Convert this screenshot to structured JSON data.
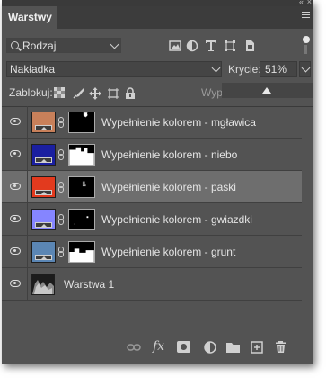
{
  "panel": {
    "tab_label": "Warstwy",
    "collapse_glyph": "«",
    "close_glyph": "×"
  },
  "filter": {
    "kind_label": "Rodzaj",
    "filter_icons": [
      "image-filter-icon",
      "adjustment-filter-icon",
      "type-filter-icon",
      "shape-filter-icon",
      "smart-object-filter-icon"
    ]
  },
  "blend": {
    "mode": "Nakładka",
    "opacity_label": "Krycie:",
    "opacity_value": "51%",
    "opacity_slider_percent": 51
  },
  "lock": {
    "label": "Zablokuj:",
    "fill_label": "Wyp"
  },
  "layers": [
    {
      "name": "Wypełnienie kolorem - mgławica",
      "color": "#c8805a",
      "selected": false,
      "mask": "nebula"
    },
    {
      "name": "Wypełnienie kolorem - niebo",
      "color": "#1a1fa0",
      "selected": false,
      "mask": "sky"
    },
    {
      "name": "Wypełnienie kolorem - paski",
      "color": "#e23a1e",
      "selected": true,
      "mask": "stripes"
    },
    {
      "name": "Wypełnienie kolorem - gwiazdki",
      "color": "#8585ff",
      "selected": false,
      "mask": "stars"
    },
    {
      "name": "Wypełnienie kolorem - grunt",
      "color": "#5b86b4",
      "selected": false,
      "mask": "ground"
    },
    {
      "name": "Warstwa 1",
      "color": "",
      "selected": false,
      "mask": "none"
    }
  ],
  "footer": {
    "icons": [
      "link-layers-icon",
      "fx-icon",
      "add-mask-icon",
      "adjustment-layer-icon",
      "new-group-icon",
      "new-layer-icon",
      "delete-icon"
    ],
    "fx_label": "fx"
  }
}
